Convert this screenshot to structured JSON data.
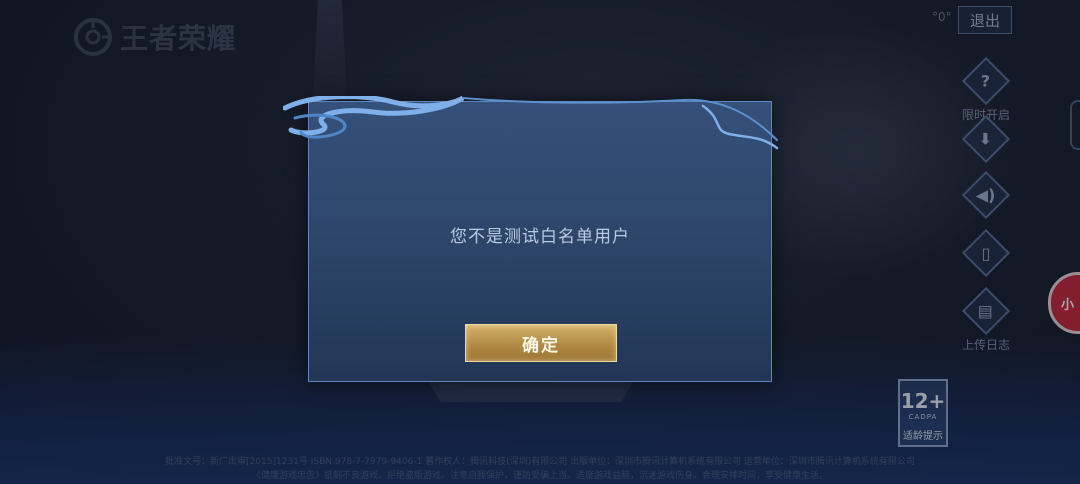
{
  "logo": {
    "text": "王者荣耀"
  },
  "header": {
    "exit_label": "退出",
    "indicator": "°0°"
  },
  "side_buttons": [
    {
      "icon": "question-icon",
      "glyph": "?",
      "label": "限时开启"
    },
    {
      "icon": "download-icon",
      "glyph": "⬇",
      "label": ""
    },
    {
      "icon": "speaker-icon",
      "glyph": "◀)",
      "label": ""
    },
    {
      "icon": "phone-switch-icon",
      "glyph": "▯",
      "label": ""
    },
    {
      "icon": "clipboard-icon",
      "glyph": "▤",
      "label": "上传日志"
    }
  ],
  "right_pill": {
    "label": "小"
  },
  "age_rating": {
    "number": "12+",
    "org": "CADPA",
    "tip": "适龄提示"
  },
  "footer": {
    "line1": "批准文号：新广出审[2015]1231号 ISBN 978-7-7979-9406-1 著作权人：腾讯科技(深圳)有限公司 出版单位：深圳市腾讯计算机系统有限公司 运营单位：深圳市腾讯计算机系统有限公司",
    "line2": "《健康游戏忠告》抵制不良游戏，拒绝盗版游戏。注意自我保护，谨防受骗上当。适度游戏益脑，沉迷游戏伤身。合理安排时间，享受健康生活。"
  },
  "dialog": {
    "message": "您不是测试白名单用户",
    "confirm_label": "确定"
  },
  "colors": {
    "dialog_border": "#5f86bd",
    "dialog_text": "#b9cbe3",
    "button_gold": "#b28a45",
    "pill_red": "#c3293a"
  }
}
